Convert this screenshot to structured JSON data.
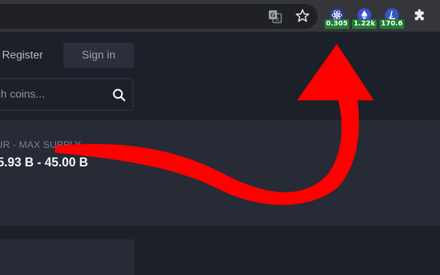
{
  "browser": {
    "toolbar": {
      "icons": [
        "translate-icon",
        "star-icon",
        "puzzle-icon"
      ],
      "extensions": [
        {
          "icon": "cosmos-atom-icon",
          "badge": "0.305",
          "color": "#3b4fd6"
        },
        {
          "icon": "ethereum-icon",
          "badge": "1.22k",
          "color": "#3b4fd6"
        },
        {
          "icon": "litecoin-icon",
          "badge": "170.6",
          "color": "#3b4fd6"
        }
      ],
      "badge_color": "#1e7d32"
    }
  },
  "header": {
    "register_label": "Register",
    "signin_label": "Sign in"
  },
  "search": {
    "placeholder": "ch coins..."
  },
  "coin_info": {
    "supply_label": "UR - MAX SUPPLY",
    "supply_value": "5.93 B - 45.00 B"
  },
  "overlay": {
    "annotation": "red-arrow-icon",
    "color": "#ff0000"
  }
}
